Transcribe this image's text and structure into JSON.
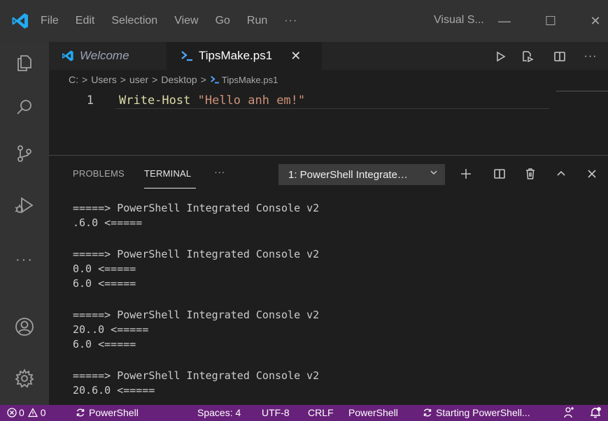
{
  "titlebar": {
    "menu": [
      "File",
      "Edit",
      "Selection",
      "View",
      "Go",
      "Run",
      "···"
    ],
    "title": "Visual S...",
    "minimize": "—",
    "maximize": "☐",
    "close": "✕"
  },
  "activity_bar": {
    "icons": [
      "explorer-icon",
      "search-icon",
      "source-control-icon",
      "run-debug-icon",
      "more-icon",
      "account-icon",
      "settings-gear-icon"
    ],
    "more_label": "···"
  },
  "tabs": [
    {
      "label": "Welcome",
      "active": false,
      "icon": "vscode-logo-icon"
    },
    {
      "label": "TipsMake.ps1",
      "active": true,
      "icon": "powershell-icon"
    }
  ],
  "tab_close": "✕",
  "editor_actions": [
    "run-icon",
    "open-changes-icon",
    "split-editor-icon",
    "more-actions-icon"
  ],
  "editor_more": "···",
  "breadcrumb": [
    "C:",
    ">",
    "Users",
    ">",
    "user",
    ">",
    "Desktop",
    ">",
    "TipsMake.ps1"
  ],
  "editor": {
    "line_number": "1",
    "keyword": "Write-Host",
    "string": "\"Hello anh em!\""
  },
  "panel": {
    "tabs": [
      "PROBLEMS",
      "TERMINAL",
      "···"
    ],
    "active_tab": "TERMINAL",
    "terminal_select": "1: PowerShell Integrate…",
    "actions": [
      "plus-icon",
      "split-terminal-icon",
      "trash-icon",
      "chevron-up-icon",
      "close-icon"
    ]
  },
  "terminal_lines": [
    [
      "=====> PowerShell Integrated Console v2",
      ".6.0 <====="
    ],
    [
      "=====> PowerShell Integrated Console v2",
      "0.0 <=====",
      "6.0 <====="
    ],
    [
      "=====> PowerShell Integrated Console v2",
      "20..0 <=====",
      "6.0 <====="
    ],
    [
      "=====> PowerShell Integrated Console v2",
      "20.6.0 <====="
    ]
  ],
  "statusbar": {
    "errors": "0",
    "warnings": "0",
    "ps_label": "PowerShell",
    "spaces": "Spaces: 4",
    "encoding": "UTF-8",
    "eol": "CRLF",
    "language": "PowerShell",
    "starting": "Starting PowerShell...",
    "color": "#68217a"
  },
  "colors": {
    "accent_blue": "#23a9f2",
    "string": "#ce9178",
    "keyword": "#dcdcaa"
  }
}
